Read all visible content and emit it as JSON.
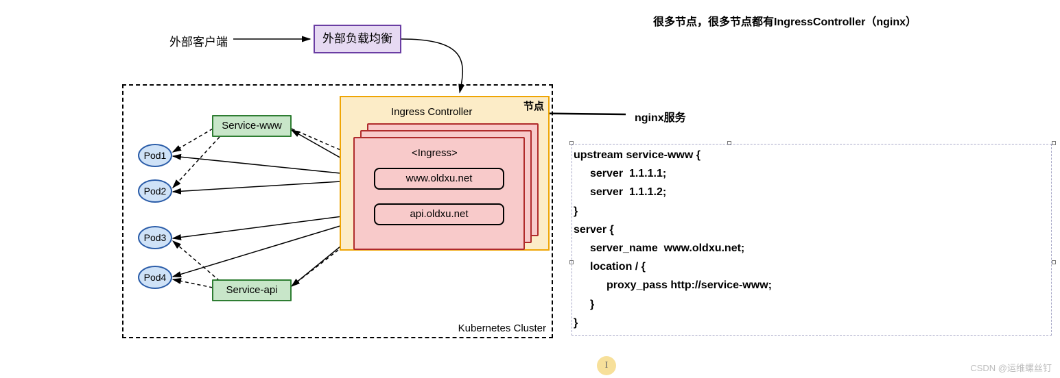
{
  "title_right": "很多节点，很多节点都有IngressController（nginx）",
  "ext_client": "外部客户端",
  "ext_lb": "外部负载均衡",
  "cluster_label": "Kubernetes Cluster",
  "node_label": "节点",
  "ingress_controller": "Ingress Controller",
  "ingress_title": "<Ingress>",
  "rules": {
    "r1": "www.oldxu.net",
    "r2": "api.oldxu.net"
  },
  "services": {
    "www": "Service-www",
    "api": "Service-api"
  },
  "pods": {
    "p1": "Pod1",
    "p2": "Pod2",
    "p3": "Pod3",
    "p4": "Pod4"
  },
  "nginx_label": "nginx服务",
  "nginx_conf": {
    "l1": "upstream service-www {",
    "l2": "server  1.1.1.1;",
    "l3": "server  1.1.1.2;",
    "l4": "}",
    "l5": "",
    "l6": "server {",
    "l7": "server_name  www.oldxu.net;",
    "l8": "location / {",
    "l9": "proxy_pass http://service-www;",
    "l10": "}",
    "l11": "}"
  },
  "cursor_char": "I",
  "watermark": "CSDN @运维螺丝钉"
}
